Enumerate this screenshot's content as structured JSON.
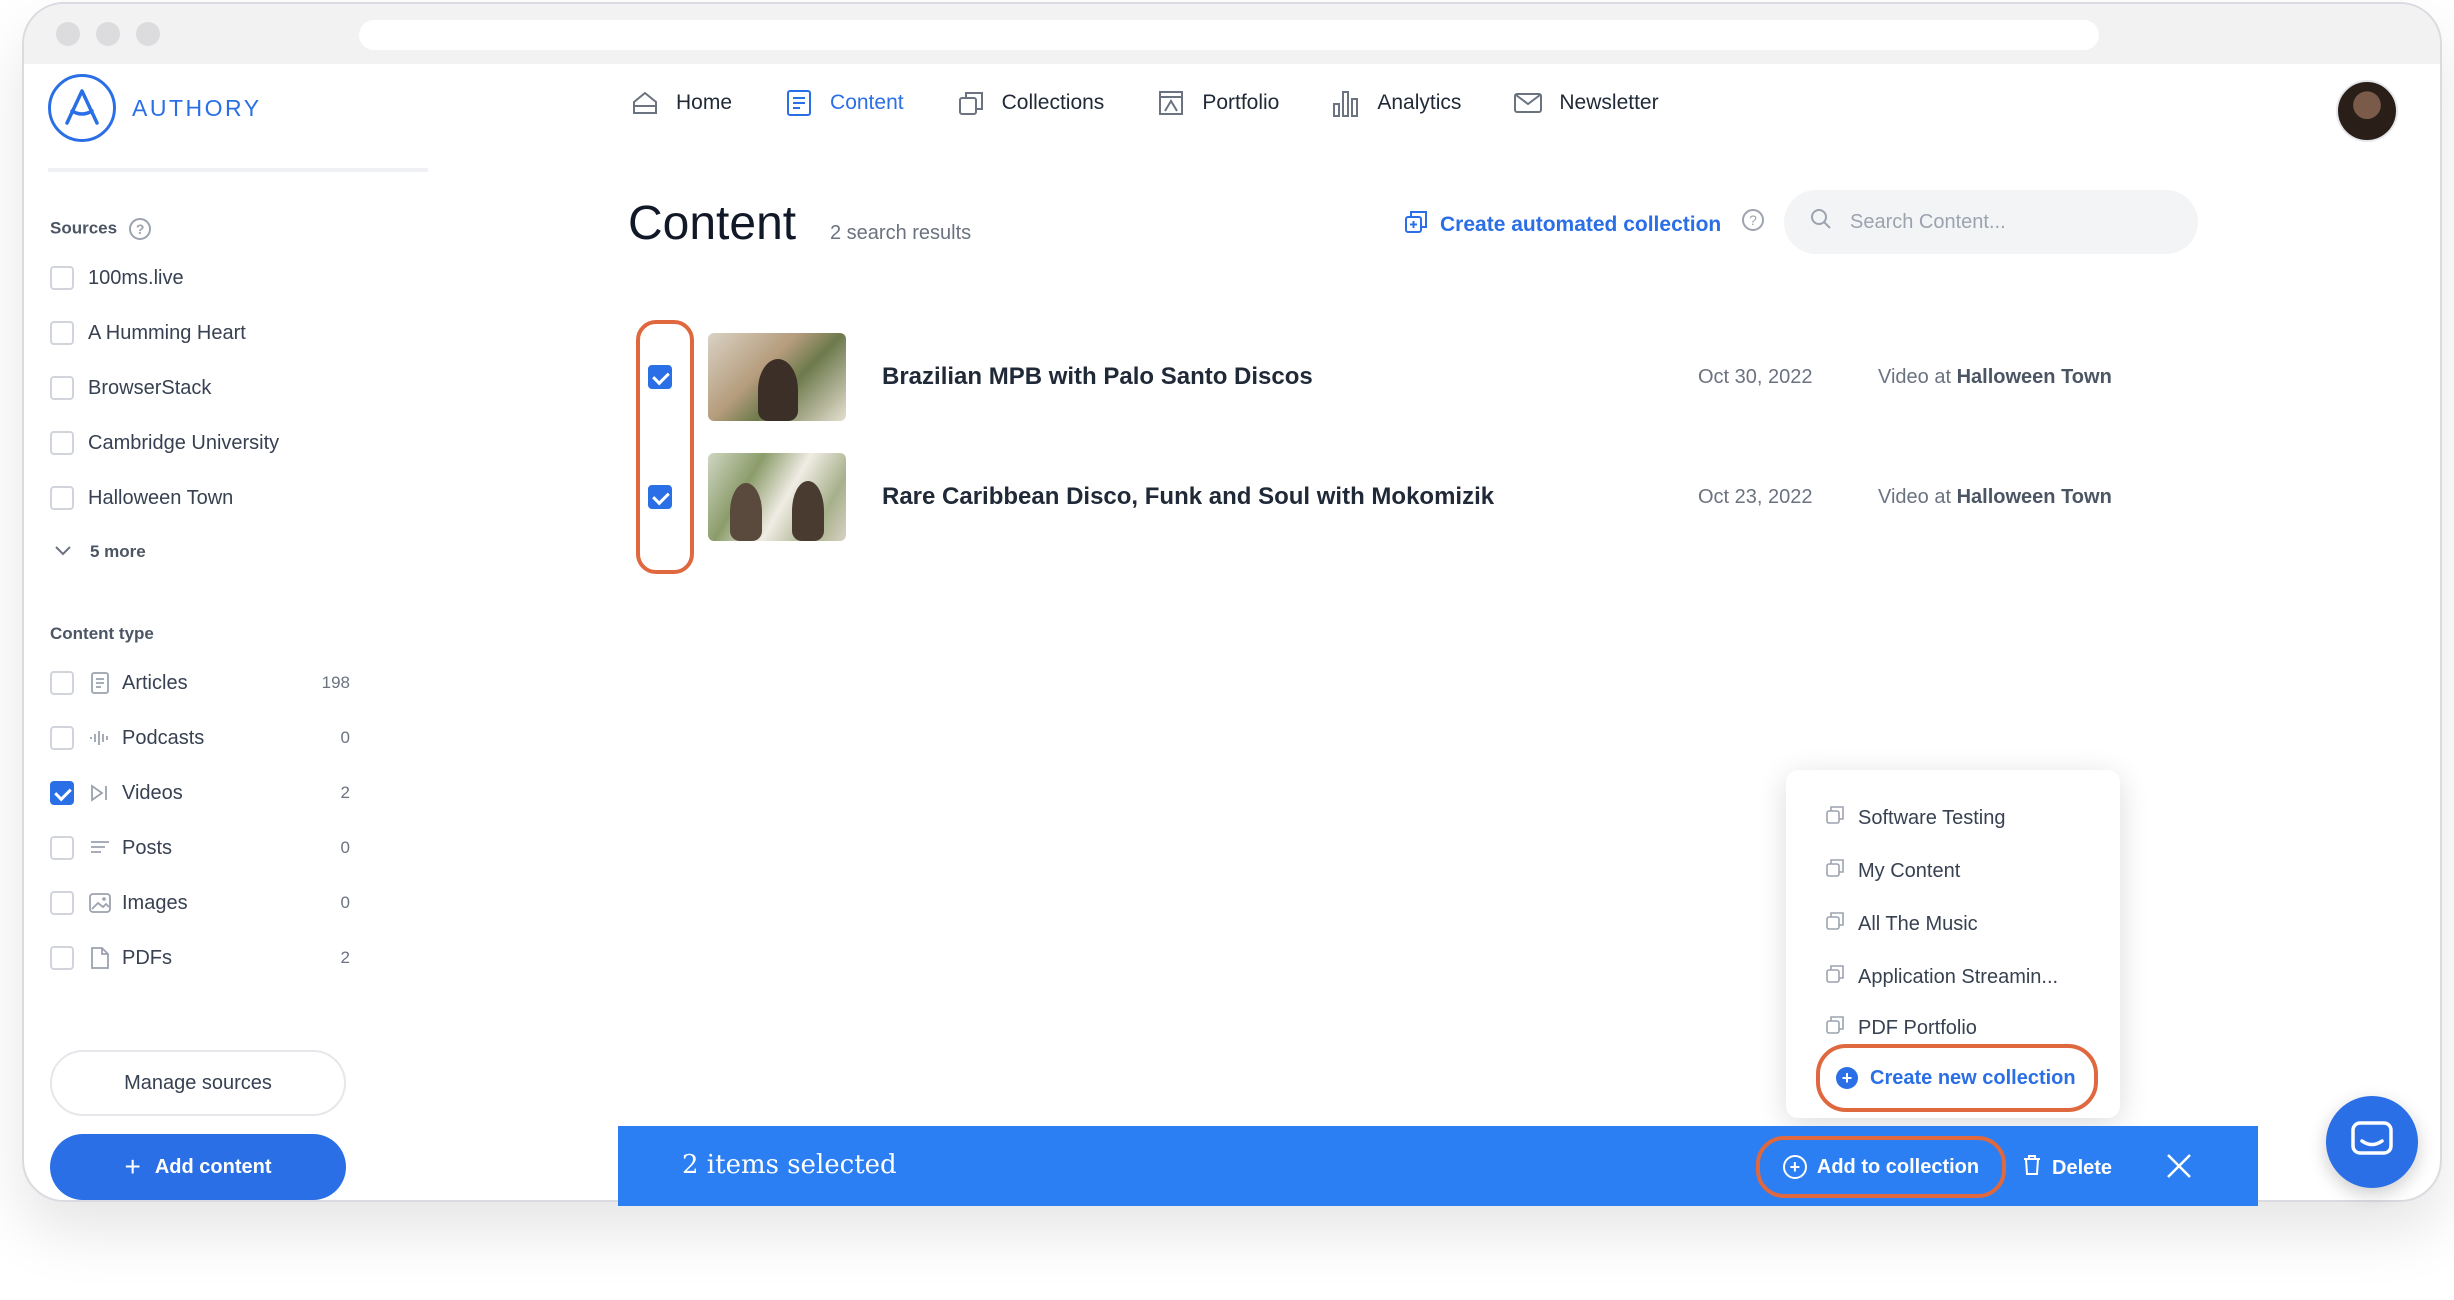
{
  "brand": {
    "name": "AUTHORY",
    "accent": "#2b6fe6",
    "highlight": "#e0683f"
  },
  "nav": [
    {
      "label": "Home",
      "icon": "home-icon"
    },
    {
      "label": "Content",
      "icon": "content-icon",
      "active": true
    },
    {
      "label": "Collections",
      "icon": "collections-icon"
    },
    {
      "label": "Portfolio",
      "icon": "portfolio-icon"
    },
    {
      "label": "Analytics",
      "icon": "analytics-icon"
    },
    {
      "label": "Newsletter",
      "icon": "newsletter-icon"
    }
  ],
  "sidebar": {
    "sources_title": "Sources",
    "sources": [
      "100ms.live",
      "A Humming Heart",
      "BrowserStack",
      "Cambridge University",
      "Halloween Town"
    ],
    "more_label": "5 more",
    "content_type_title": "Content type",
    "content_types": [
      {
        "label": "Articles",
        "count": "198",
        "checked": false,
        "icon": "article-icon"
      },
      {
        "label": "Podcasts",
        "count": "0",
        "checked": false,
        "icon": "podcast-icon"
      },
      {
        "label": "Videos",
        "count": "2",
        "checked": true,
        "icon": "video-icon"
      },
      {
        "label": "Posts",
        "count": "0",
        "checked": false,
        "icon": "post-icon"
      },
      {
        "label": "Images",
        "count": "0",
        "checked": false,
        "icon": "image-icon"
      },
      {
        "label": "PDFs",
        "count": "2",
        "checked": false,
        "icon": "pdf-icon"
      }
    ],
    "manage_sources_label": "Manage sources",
    "add_content_label": "Add content"
  },
  "main": {
    "title": "Content",
    "results": "2 search results",
    "auto_collection_label": "Create automated collection",
    "search_placeholder": "Search Content...",
    "items": [
      {
        "title": "Brazilian MPB with Palo Santo Discos",
        "date": "Oct 30, 2022",
        "type_prefix": "Video at",
        "source": "Halloween Town",
        "checked": true
      },
      {
        "title": "Rare Caribbean Disco, Funk and Soul with Mokomizik",
        "date": "Oct 23, 2022",
        "type_prefix": "Video at",
        "source": "Halloween Town",
        "checked": true
      }
    ]
  },
  "collection_menu": {
    "items": [
      "Software Testing",
      "My Content",
      "All The Music",
      "Application Streamin...",
      "PDF Portfolio"
    ],
    "create_label": "Create new collection"
  },
  "action_bar": {
    "selected_label": "2 items selected",
    "add_label": "Add to collection",
    "delete_label": "Delete"
  }
}
